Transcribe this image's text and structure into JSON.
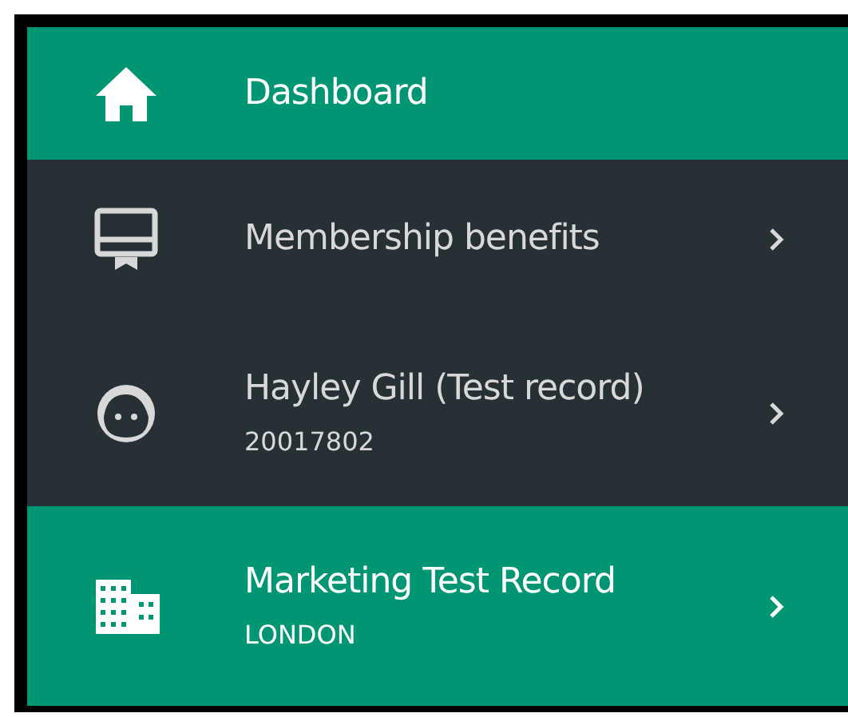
{
  "menu": {
    "items": [
      {
        "label": "Dashboard",
        "active": true,
        "chevron": false
      },
      {
        "label": "Membership benefits",
        "active": false,
        "chevron": true
      },
      {
        "label": "Hayley Gill (Test record)",
        "subtitle": "20017802",
        "active": false,
        "chevron": true
      },
      {
        "label": "Marketing Test Record",
        "subtitle": "LONDON",
        "active": true,
        "chevron": true
      }
    ]
  }
}
